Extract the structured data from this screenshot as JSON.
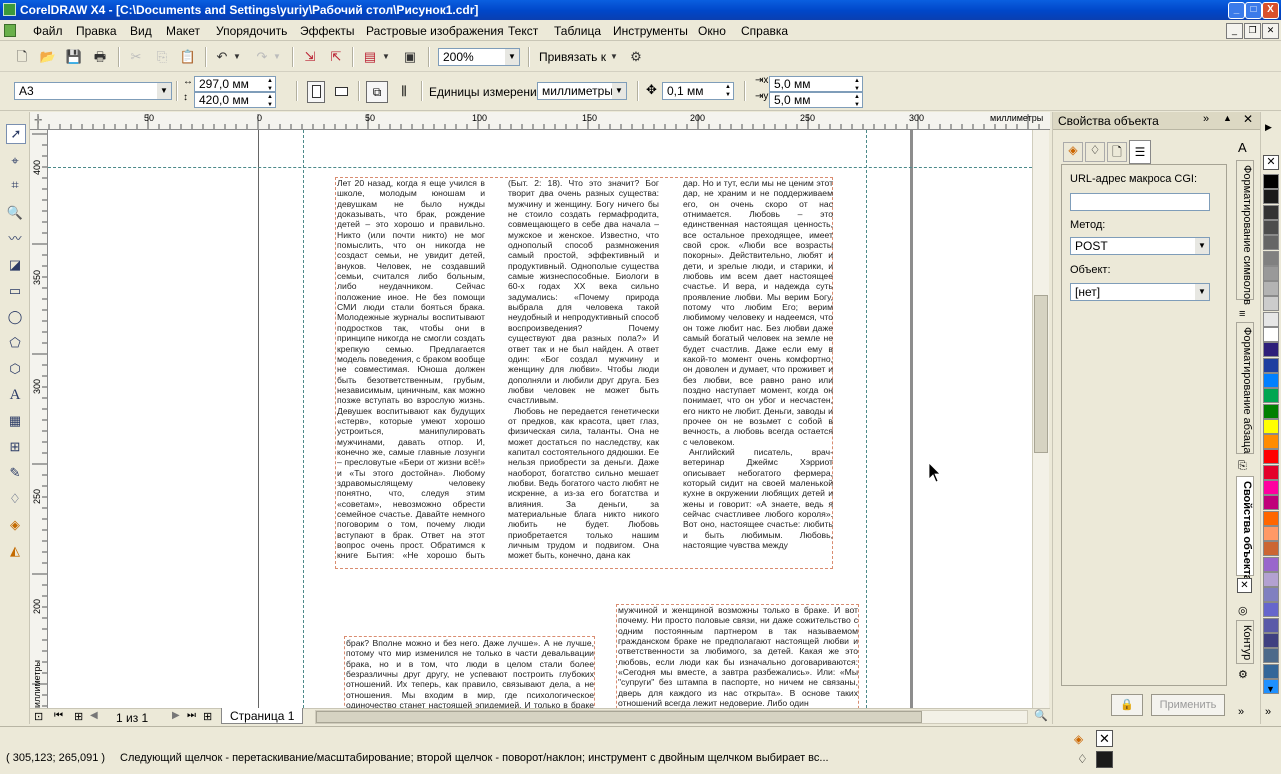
{
  "app": {
    "title": "CorelDRAW X4 - [C:\\Documents and Settings\\yuriy\\Рабочий стол\\Рисунок1.cdr]",
    "min": "_",
    "max": "□",
    "close": "X"
  },
  "menu": [
    "Файл",
    "Правка",
    "Вид",
    "Макет",
    "Упорядочить",
    "Эффекты",
    "Растровые изображения",
    "Текст",
    "Таблица",
    "Инструменты",
    "Окно",
    "Справка"
  ],
  "toolbar": {
    "zoom": "200%",
    "snap_label": "Привязать к"
  },
  "propbar": {
    "paper": "A3",
    "width": "297,0 мм",
    "height": "420,0 мм",
    "units_label": "Единицы измерения:",
    "units": "миллиметры",
    "nudge": "0,1 мм",
    "dup_x": "5,0 мм",
    "dup_y": "5,0 мм"
  },
  "ruler": {
    "h_ticks": [
      "50",
      "0",
      "50",
      "100",
      "150",
      "200",
      "250",
      "300"
    ],
    "h_unit": "миллиметры",
    "v_ticks": [
      "400",
      "350",
      "300",
      "250",
      "200"
    ],
    "v_unit": "миллиметры"
  },
  "document": {
    "col1": "Лет 20 назад, когда я еще учился в школе, молодым юношам и девушкам не было нужды доказывать, что брак, рождение детей – это хорошо и правильно. Никто (или почти никто) не мог помыслить, что он никогда не создаст семьи, не увидит детей, внуков. Человек, не создавший семьи, считался либо больным, либо неудачником. Сейчас положение иное. Не без помощи СМИ люди стали бояться брака. Молодежные журналы воспитывают подростков так, чтобы они в принципе никогда не смогли создать крепкую семью. Предлагается модель поведения, с браком вообще не совместимая. Юноша должен быть безответственным, грубым, независимым, циничным, как можно позже вступать во взрослую жизнь. Девушек воспитывают как будущих «стерв», которые умеют хорошо устроиться, манипулировать мужчинами, давать отпор. И, конечно же, самые главные лозунги – преслову­тые «Бери от жизни всё!» и «Ты этого достойна». Любому здравомыслящему человеку понятно, что, следуя этим «советам», невозможно обрести семейное счастье. Давайте немного поговорим о том, почему люди вступают в брак. Ответ на этот вопрос очень прост. Обратимся к книге Бытия: «Не хорошо быть человеку одному»",
    "col2a": "(Быт. 2: 18). Что это значит? Бог творит два очень разных существа: мужчину и женщину. Богу ничего бы не стоило создать гермафродита, совмещающего в себе два начала – мужское и женское. Известно, что однополый способ размножения самый простой, эффективный и продуктивный. Однополые существа самые жизнеспособные. Биологи в 60-х годах XX века сильно задумались: «Почему природа выбрала для человека такой неудобный и непродуктивный способ воспроизведения? Почему существуют два разных пола?» И ответ так и не был найден. А ответ один: «Бог создал мужчину и женщину для любви». Чтобы люди дополняли и любили друг друга. Без любви человек не может быть счастливым.",
    "col2b": "Любовь не передается генетически от предков, как красота, цвет глаз, физическая сила, таланты. Она не может достаться по наследству, как капитал состоятельного дядюшки. Ее нельзя приобрести за деньги. Даже наоборот, богатство сильно мешает любви. Ведь богатого часто любят не искренне, а из-за его богатства и влияния. За деньги, за материальные блага никто никого любить не будет. Любовь приобретается только нашим личным трудом и подвигом. Она может быть, конечно, дана как",
    "col3a": "дар. Но и тут, если мы не ценим этот дар, не храним и не поддерживаем его, он очень скоро от нас отнимается. Любовь – это единственная настоящая ценность, все остальное преходящее, имеет свой срок. «Люби все возрасты покорны». Действительно, любят и дети, и зрелые люди, и старики, и любовь им всем дает настоящее счастье. И вера, и надежда суть проявление любви. Мы верим Богу, потому что любим Его; верим любимому человеку и надеемся, что он тоже любит нас. Без любви даже самый богатый человек на земле не будет счастлив. Даже если ему в какой-то момент очень комфортно, он доволен и думает, что проживет и без любви, все равно рано или поздно наступает момент, когда он понимает, что он убог и несчастен, его никто не любит. Деньги, заводы и прочее он не возьмет с собой в вечность, а любовь всегда остается с человеком.",
    "col3b": "Английский писатель, врач-ветеринар Джеймс Хэрриот описывает небогатого фермера, который сидит на своей маленькой кухне в окружении любящих детей и жены и говорит: «А знаете, ведь я сейчас счастливее любого короля». Вот оно, настоящее счастье: любить и быть любимым. Любовь, настоящие чувства между",
    "bottom_left": "брак? Вполне можно и без него. Даже лучше». А не лучше, потому что мир изменился не только в части девальвации брака, но и в том, что люди в целом стали более безразличны друг другу, не успевают построить глубоких отношений. Их теперь, как правило, связывают дела, а не отношения. Мы входим в мир, где психологическое одиночество станет настоящей эпидемией. И только в браке остается",
    "bottom_right": "мужчиной и женщиной возможны только в браке. И вот почему. Ни просто половые связи, ни даже сожительство с одним постоянным партнером в так называемом гражданском браке не предполагают настоящей любви и ответственности за любимого, за детей. Какая же это любовь, если люди как бы изначально договариваются: «Сегодня мы вместе, а завтра разбежались». Или: «Мы \"супруги\" без штампа в паспорте, но ничем не связаны, дверь для каждого из нас открыта». В основе таких отношений всегда лежит недоверие. Либо один"
  },
  "pages": {
    "counter": "1 из 1",
    "tab": "Страница 1"
  },
  "docker": {
    "title": "Свойства объекта",
    "url_label": "URL-адрес макроса CGI:",
    "url_value": "",
    "method_label": "Метод:",
    "method_value": "POST",
    "object_label": "Объект:",
    "object_value": "[нет]",
    "apply": "Применить",
    "tabs": [
      "Форматирование символов",
      "Форматирование абзаца",
      "Свойства объекта",
      "Контур"
    ]
  },
  "palette": [
    "#000000",
    "#1a1a1a",
    "#333333",
    "#4d4d4d",
    "#666666",
    "#808080",
    "#999999",
    "#b3b3b3",
    "#cccccc",
    "#e6e6e6",
    "#ffffff",
    "#2e1f7a",
    "#1e3fa0",
    "#0080ff",
    "#00a651",
    "#008000",
    "#ffff00",
    "#ff8c00",
    "#ff0000",
    "#e4002b",
    "#ff00a0",
    "#c0007a",
    "#ff6600",
    "#ff9966",
    "#cc6633",
    "#9966cc",
    "#b3a1d1",
    "#8080c0",
    "#6666cc",
    "#5a5aa8",
    "#404080",
    "#4d6a8a",
    "#336699",
    "#1e90ff"
  ],
  "status": {
    "coords": "( 305,123; 265,091 )",
    "hint": "Следующий щелчок - перетаскивание/масштабирование; второй щелчок - поворот/наклон; инструмент с двойным щелчком выбирает вс..."
  }
}
